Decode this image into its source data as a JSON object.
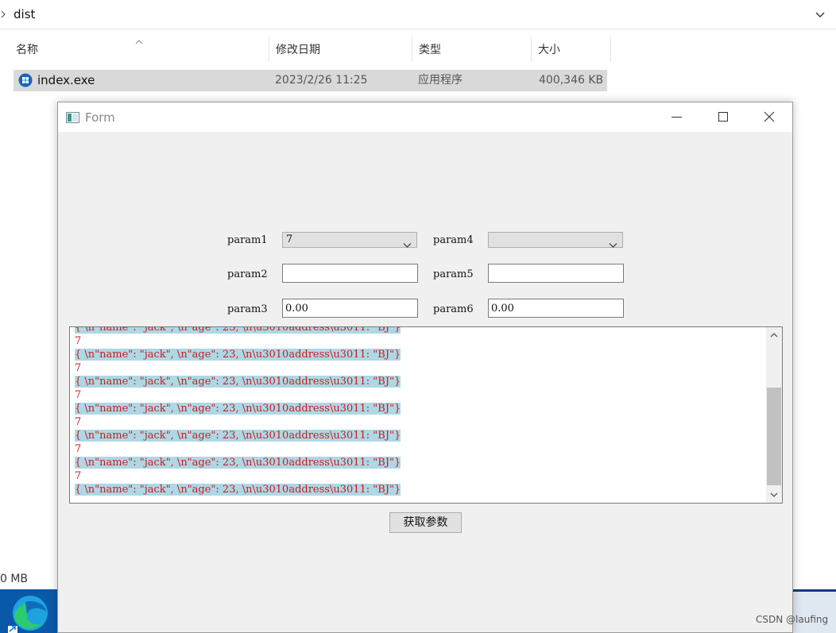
{
  "explorer": {
    "path": "dist",
    "columns": {
      "name": "名称",
      "date": "修改日期",
      "type": "类型",
      "size": "大小"
    },
    "files": [
      {
        "name": "index.exe",
        "date": "2023/2/26 11:25",
        "type": "应用程序",
        "size": "400,346 KB"
      }
    ],
    "status_size": "0 MB"
  },
  "form": {
    "title": "Form",
    "params": {
      "param1": {
        "label": "param1",
        "value": "7"
      },
      "param2": {
        "label": "param2",
        "value": ""
      },
      "param3": {
        "label": "param3",
        "value": "0.00"
      },
      "param4": {
        "label": "param4",
        "value": ""
      },
      "param5": {
        "label": "param5",
        "value": ""
      },
      "param6": {
        "label": "param6",
        "value": "0.00"
      }
    },
    "output_lines": [
      {
        "text": "{ \\n\"name\": \"jack\", \\n\"age\": 23, \\n\\u3010address\\u3011: \"BJ\"}",
        "highlight": true
      },
      {
        "text": "7",
        "highlight": false
      },
      {
        "text": "{ \\n\"name\": \"jack\", \\n\"age\": 23, \\n\\u3010address\\u3011: \"BJ\"}",
        "highlight": true
      },
      {
        "text": "7",
        "highlight": false
      },
      {
        "text": "{ \\n\"name\": \"jack\", \\n\"age\": 23, \\n\\u3010address\\u3011: \"BJ\"}",
        "highlight": true
      },
      {
        "text": "7",
        "highlight": false
      },
      {
        "text": "{ \\n\"name\": \"jack\", \\n\"age\": 23, \\n\\u3010address\\u3011: \"BJ\"}",
        "highlight": true
      },
      {
        "text": "7",
        "highlight": false
      },
      {
        "text": "{ \\n\"name\": \"jack\", \\n\"age\": 23, \\n\\u3010address\\u3011: \"BJ\"}",
        "highlight": true
      },
      {
        "text": "7",
        "highlight": false
      },
      {
        "text": "{ \\n\"name\": \"jack\", \\n\"age\": 23, \\n\\u3010address\\u3011: \"BJ\"}",
        "highlight": true
      },
      {
        "text": "7",
        "highlight": false
      },
      {
        "text": "{ \\n\"name\": \"jack\", \\n\"age\": 23, \\n\\u3010address\\u3011: \"BJ\"}",
        "highlight": true
      }
    ],
    "button_label": "获取参数",
    "text_color": "#d11a1a",
    "highlight_color": "#add8e6"
  },
  "watermark": "CSDN @laufing"
}
